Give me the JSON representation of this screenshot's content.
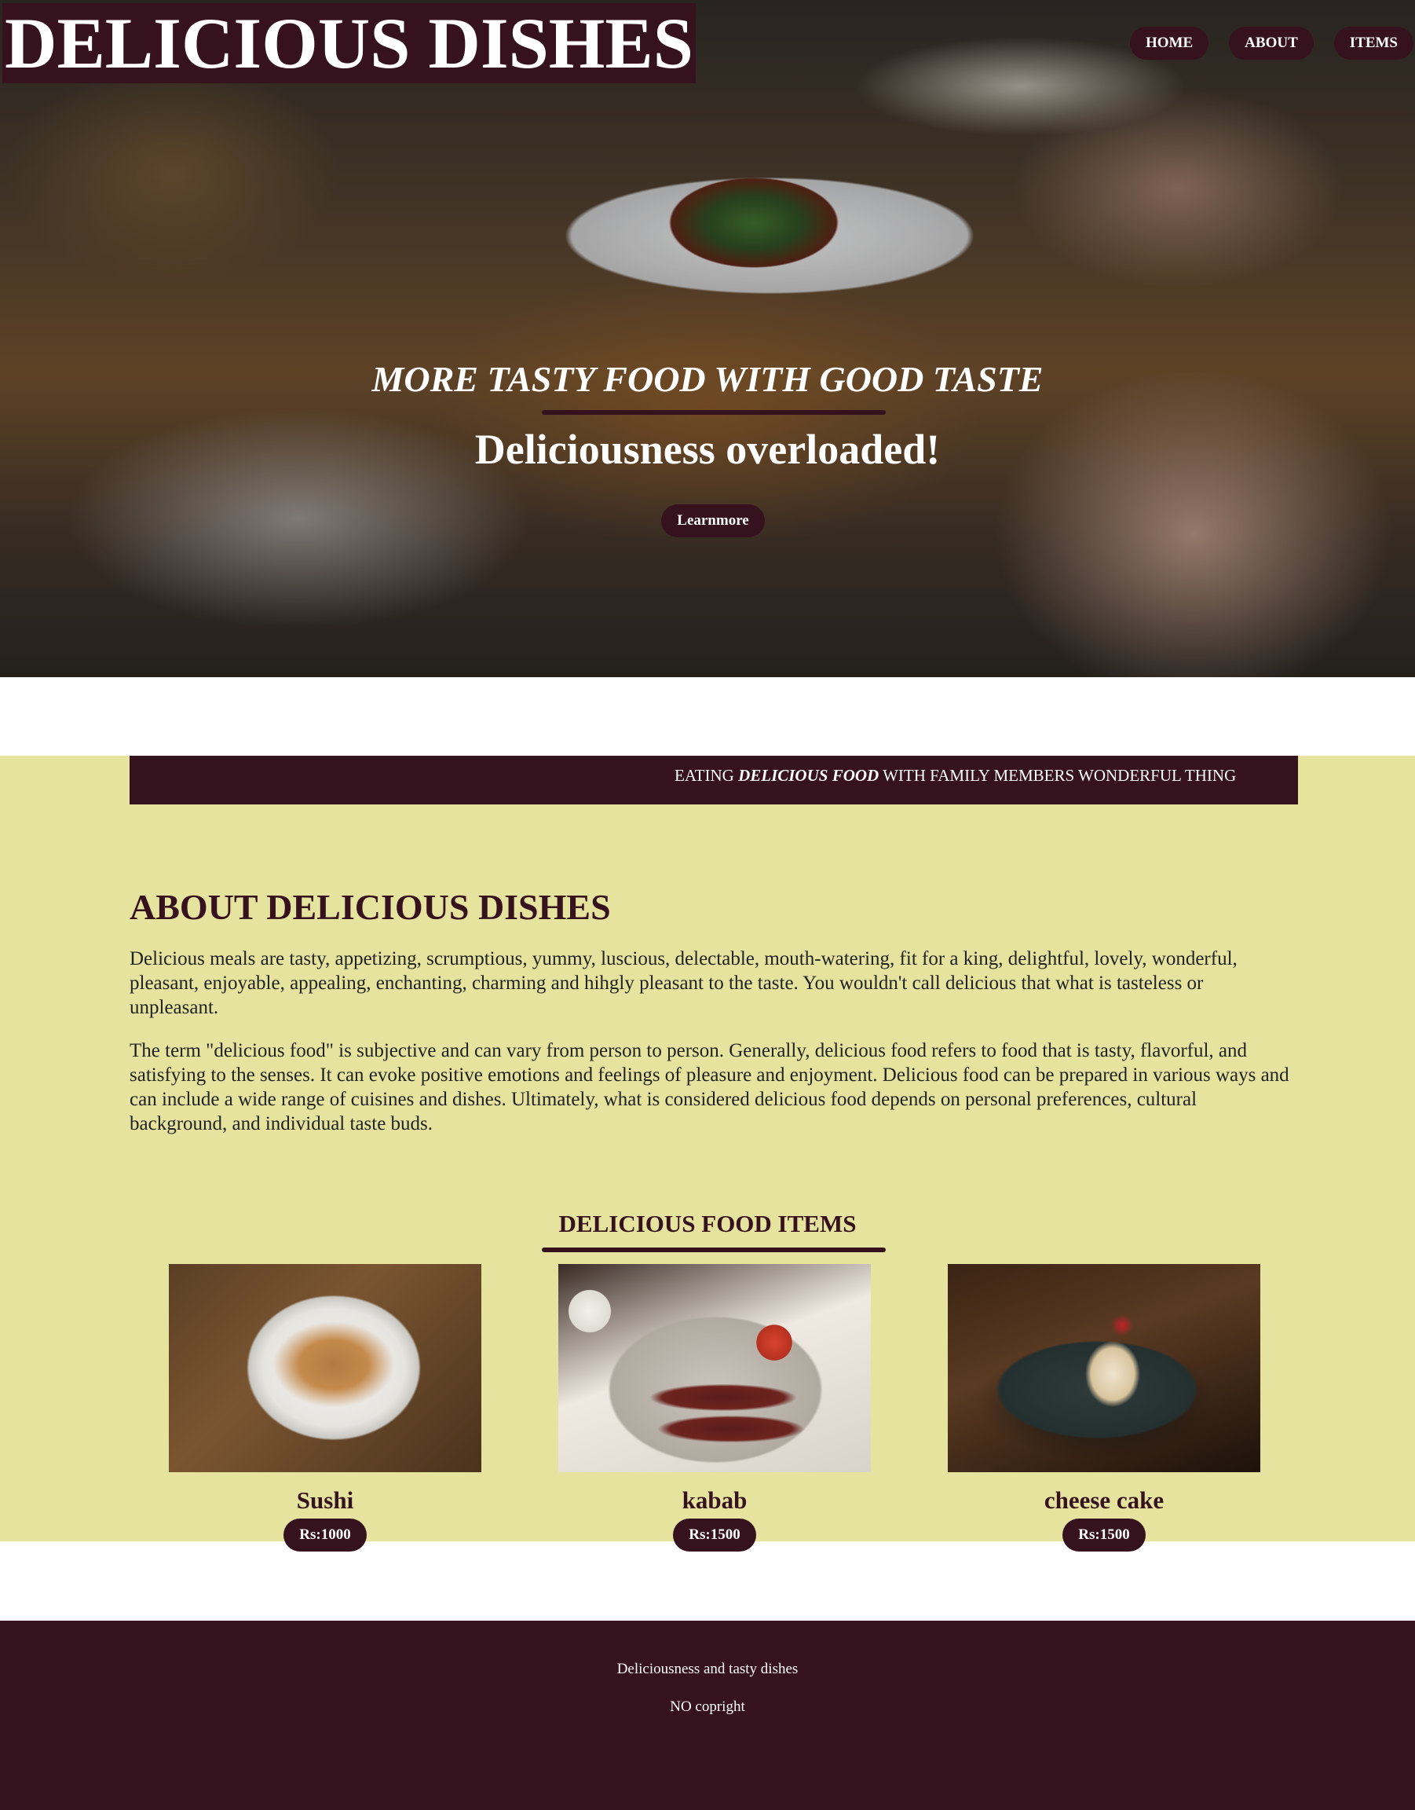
{
  "header": {
    "logo_text": "DELICIOUS DISHES",
    "nav": [
      "HOME",
      "ABOUT",
      "ITEMS"
    ]
  },
  "hero": {
    "tagline": "MORE TASTY FOOD WITH GOOD TASTE",
    "headline": "Deliciousness overloaded!",
    "button_label": "Learnmore"
  },
  "marquee": {
    "before": "EATING ",
    "emphasis": "DELICIOUS FOOD",
    "after": " WITH FAMILY MEMBERS WONDERFUL THING"
  },
  "about": {
    "title": "ABOUT DELICIOUS DISHES",
    "paragraphs": [
      "Delicious meals are tasty, appetizing, scrumptious, yummy, luscious, delectable, mouth-watering, fit for a king, delightful, lovely, wonderful, pleasant, enjoyable, appealing, enchanting, charming and hihgly pleasant to the taste. You wouldn't call delicious that what is tasteless or unpleasant.",
      "The term \"delicious food\" is subjective and can vary from person to person. Generally, delicious food refers to food that is tasty, flavorful, and satisfying to the senses. It can evoke positive emotions and feelings of pleasure and enjoyment. Delicious food can be prepared in various ways and can include a wide range of cuisines and dishes. Ultimately, what is considered delicious food depends on personal preferences, cultural background, and individual taste buds."
    ]
  },
  "items": {
    "title": "DELICIOUS FOOD ITEMS",
    "cards": [
      {
        "name": "Sushi",
        "price": "Rs:1000"
      },
      {
        "name": "kabab",
        "price": "Rs:1500"
      },
      {
        "name": "cheese cake",
        "price": "Rs:1500"
      }
    ]
  },
  "footer": {
    "line1": "Deliciousness and tasty dishes",
    "line2": "NO copright"
  },
  "colors": {
    "brand": "#35121d",
    "band": "#e6e39e",
    "text": "#ffffff"
  }
}
